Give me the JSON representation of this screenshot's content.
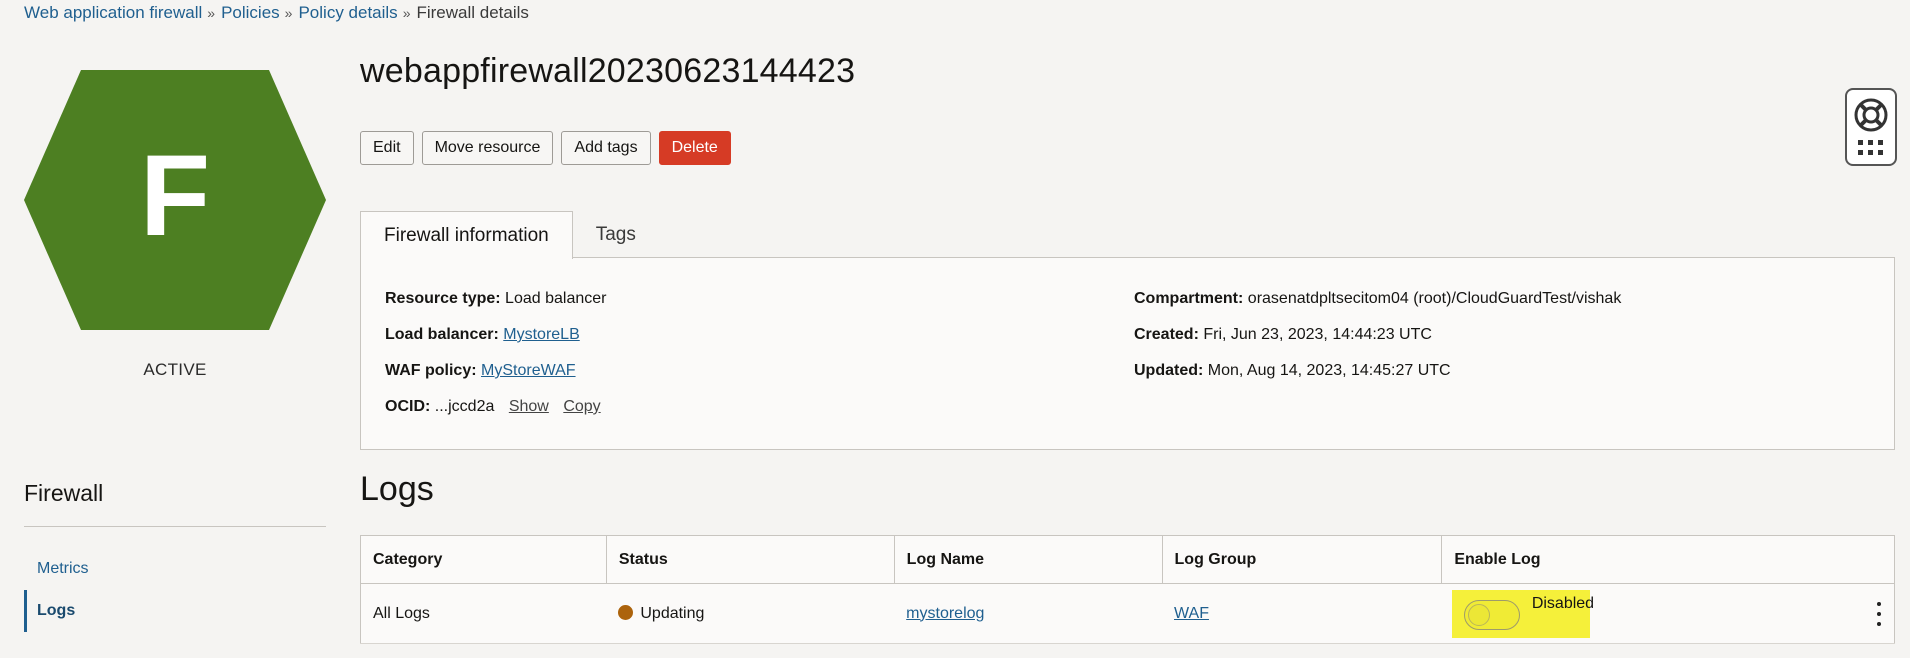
{
  "breadcrumb": {
    "items": [
      "Web application firewall",
      "Policies",
      "Policy details"
    ],
    "current": "Firewall details",
    "separator": "»"
  },
  "resource": {
    "letter": "F",
    "state": "ACTIVE",
    "color": "#4d7f22"
  },
  "page": {
    "title": "webappfirewall20230623144423"
  },
  "actions": {
    "edit": "Edit",
    "move": "Move resource",
    "tags": "Add tags",
    "delete": "Delete"
  },
  "tabs": {
    "info": "Firewall information",
    "tags": "Tags"
  },
  "info": {
    "resource_type_label": "Resource type:",
    "resource_type_value": "Load balancer",
    "load_balancer_label": "Load balancer:",
    "load_balancer_value": "MystoreLB",
    "waf_policy_label": "WAF policy:",
    "waf_policy_value": "MyStoreWAF",
    "ocid_label": "OCID:",
    "ocid_value": "...jccd2a",
    "ocid_show": "Show",
    "ocid_copy": "Copy",
    "compartment_label": "Compartment:",
    "compartment_value": "orasenatdpltsecitom04 (root)/CloudGuardTest/vishak",
    "created_label": "Created:",
    "created_value": "Fri, Jun 23, 2023, 14:44:23 UTC",
    "updated_label": "Updated:",
    "updated_value": "Mon, Aug 14, 2023, 14:45:27 UTC"
  },
  "resources": {
    "title": "Firewall",
    "items": [
      "Metrics",
      "Logs"
    ]
  },
  "logs": {
    "title": "Logs",
    "columns": [
      "Category",
      "Status",
      "Log Name",
      "Log Group",
      "Enable Log"
    ],
    "rows": [
      {
        "category": "All Logs",
        "status": "Updating",
        "log_name": "mystorelog",
        "log_group": "WAF",
        "enable_label": "Disabled"
      }
    ]
  },
  "icons": {
    "help": "lifebuoy-icon",
    "apps": "grid-icon",
    "row_menu": "kebab-menu-icon"
  },
  "colors": {
    "link": "#1f5f8f",
    "danger": "#d63b25",
    "status_updating": "#ac630c",
    "highlight": "#f5f03a"
  }
}
